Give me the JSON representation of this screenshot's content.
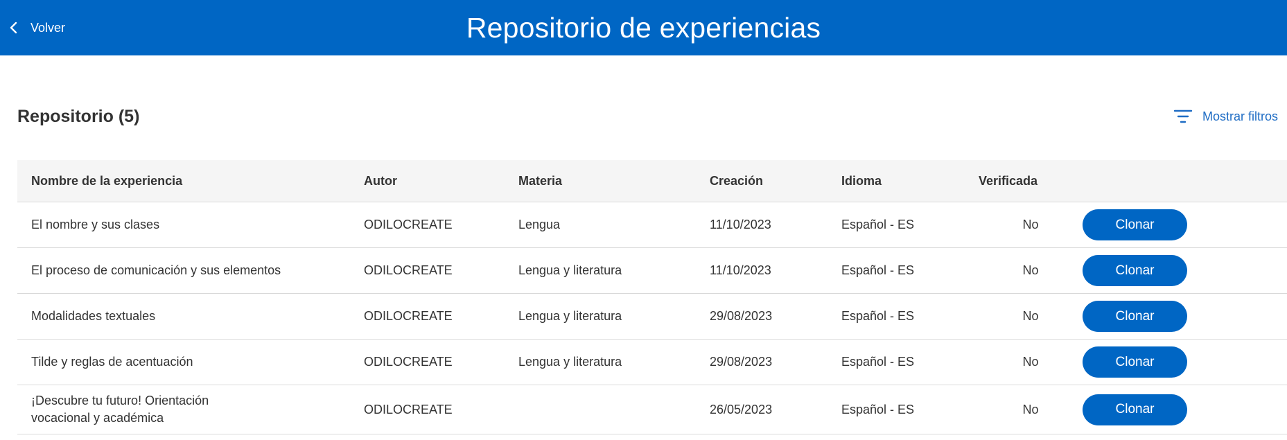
{
  "header": {
    "back_label": "Volver",
    "title": "Repositorio de experiencias",
    "background_color": "#0066c4"
  },
  "section": {
    "title": "Repositorio (5)",
    "filters_label": "Mostrar filtros"
  },
  "table": {
    "columns": [
      "Nombre de la experiencia",
      "Autor",
      "Materia",
      "Creación",
      "Idioma",
      "Verificada",
      ""
    ],
    "rows": [
      {
        "name": "El nombre y sus clases",
        "author": "ODILOCREATE",
        "subject": "Lengua",
        "created": "11/10/2023",
        "language": "Español - ES",
        "verified": "No",
        "action": "Clonar"
      },
      {
        "name": "El proceso de comunicación y sus elementos",
        "author": "ODILOCREATE",
        "subject": "Lengua y literatura",
        "created": "11/10/2023",
        "language": "Español - ES",
        "verified": "No",
        "action": "Clonar"
      },
      {
        "name": "Modalidades textuales",
        "author": "ODILOCREATE",
        "subject": "Lengua y literatura",
        "created": "29/08/2023",
        "language": "Español - ES",
        "verified": "No",
        "action": "Clonar"
      },
      {
        "name": "Tilde y reglas de acentuación",
        "author": "ODILOCREATE",
        "subject": "Lengua y literatura",
        "created": "29/08/2023",
        "language": "Español - ES",
        "verified": "No",
        "action": "Clonar"
      },
      {
        "name_line1": "¡Descubre tu futuro! Orientación",
        "name_line2": "vocacional y académica",
        "author": "ODILOCREATE",
        "subject": "",
        "created": "26/05/2023",
        "language": "Español - ES",
        "verified": "No",
        "action": "Clonar"
      }
    ]
  },
  "icons": {
    "back": "chevron-left-icon",
    "filters": "filter-icon"
  }
}
